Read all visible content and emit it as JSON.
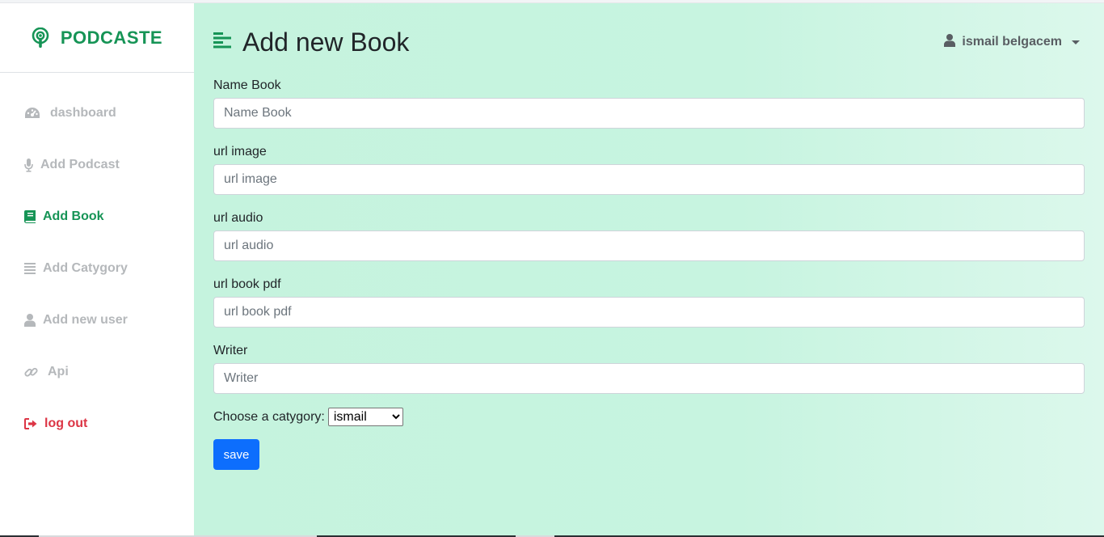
{
  "brand": {
    "name": "PODCASTE",
    "icon": "podcast-icon"
  },
  "sidebar": {
    "items": [
      {
        "label": "dashboard",
        "icon": "tachometer-icon",
        "state": "inactive"
      },
      {
        "label": "Add Podcast",
        "icon": "microphone-icon",
        "state": "inactive"
      },
      {
        "label": "Add Book",
        "icon": "book-icon",
        "state": "active"
      },
      {
        "label": "Add Catygory",
        "icon": "list-icon",
        "state": "inactive"
      },
      {
        "label": "Add new user",
        "icon": "user-icon",
        "state": "inactive"
      },
      {
        "label": "Api",
        "icon": "link-icon",
        "state": "inactive"
      },
      {
        "label": "log out",
        "icon": "sign-out-icon",
        "state": "danger"
      }
    ]
  },
  "header": {
    "title": "Add new Book",
    "menu_icon": "align-left-icon",
    "user_name": "ismail belgacem"
  },
  "form": {
    "fields": [
      {
        "label": "Name Book",
        "placeholder": "Name Book",
        "value": ""
      },
      {
        "label": "url image",
        "placeholder": "url image",
        "value": ""
      },
      {
        "label": "url audio",
        "placeholder": "url audio",
        "value": ""
      },
      {
        "label": "url book pdf",
        "placeholder": "url book pdf",
        "value": ""
      },
      {
        "label": "Writer",
        "placeholder": "Writer",
        "value": ""
      }
    ],
    "category_label": "Choose a catygory:",
    "category_selected": "ismail",
    "save_label": "save"
  },
  "colors": {
    "brand_green": "#169456",
    "inactive_gray": "#b5b8bb",
    "danger_red": "#dc3545",
    "primary_blue": "#0d6efd",
    "main_bg": "#c5f3de"
  }
}
